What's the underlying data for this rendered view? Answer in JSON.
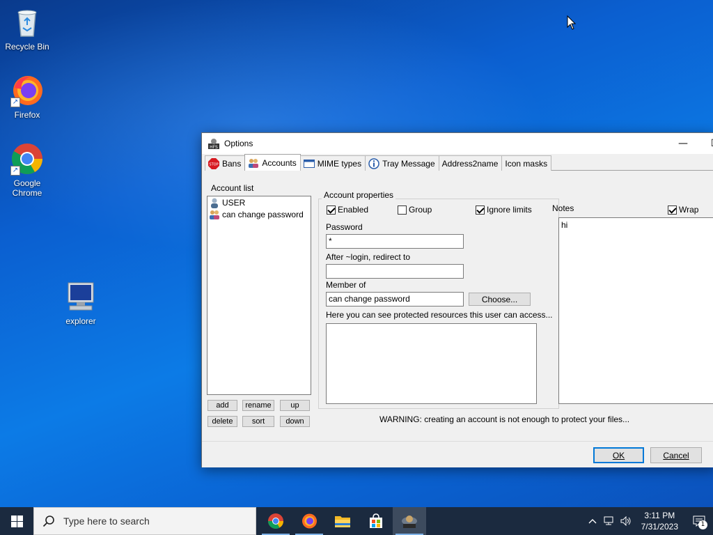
{
  "desktop": {
    "icons": [
      {
        "label": "Recycle Bin"
      },
      {
        "label": "Firefox"
      },
      {
        "label": "Google Chrome"
      },
      {
        "label": "explorer"
      }
    ]
  },
  "window": {
    "title": "Options",
    "tabs": [
      {
        "label": "Bans",
        "icon": "stop-icon"
      },
      {
        "label": "Accounts",
        "icon": "users-icon",
        "active": true
      },
      {
        "label": "MIME types",
        "icon": "window-icon"
      },
      {
        "label": "Tray Message",
        "icon": "info-icon"
      },
      {
        "label": "Address2name"
      },
      {
        "label": "Icon masks"
      }
    ],
    "account_list_label": "Account list",
    "accounts": [
      {
        "name": "USER",
        "icon": "user-icon"
      },
      {
        "name": "can change password",
        "icon": "group-icon"
      }
    ],
    "list_buttons": {
      "add": "add",
      "rename": "rename",
      "up": "up",
      "delete": "delete",
      "sort": "sort",
      "down": "down"
    },
    "properties": {
      "group_title": "Account properties",
      "enabled_label": "Enabled",
      "enabled": true,
      "group_label": "Group",
      "group": false,
      "ignore_limits_label": "Ignore limits",
      "ignore_limits": true,
      "password_label": "Password",
      "password_value": "*",
      "redirect_label": "After ~login, redirect to",
      "redirect_value": "",
      "member_of_label": "Member of",
      "member_of_value": "can change password",
      "choose_label": "Choose...",
      "resources_label": "Here you can see protected resources this user can access..."
    },
    "notes": {
      "label": "Notes",
      "wrap_label": "Wrap",
      "wrap": true,
      "value": "hi"
    },
    "warning": "WARNING: creating an account is not enough to protect  your files...",
    "ok_label": "OK",
    "cancel_label": "Cancel"
  },
  "taskbar": {
    "search_placeholder": "Type here to search",
    "time": "3:11 PM",
    "date": "7/31/2023",
    "notification_count": "1"
  }
}
